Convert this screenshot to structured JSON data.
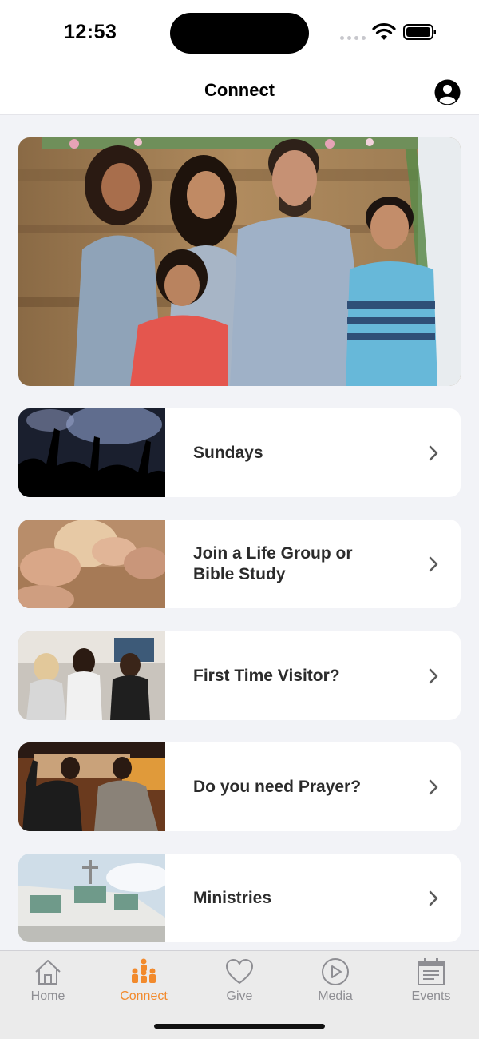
{
  "status": {
    "time": "12:53"
  },
  "nav": {
    "title": "Connect"
  },
  "colors": {
    "accent": "#f28a2c",
    "inactive": "#8e8e93"
  },
  "list": [
    {
      "label": "Sundays",
      "icon": "chevron-right-icon"
    },
    {
      "label": "Join a Life Group or\nBible Study",
      "icon": "chevron-right-icon"
    },
    {
      "label": "First Time Visitor?",
      "icon": "chevron-right-icon"
    },
    {
      "label": "Do you need Prayer?",
      "icon": "chevron-right-icon"
    },
    {
      "label": "Ministries",
      "icon": "chevron-right-icon"
    }
  ],
  "tabs": [
    {
      "label": "Home",
      "icon": "house-icon",
      "active": false
    },
    {
      "label": "Connect",
      "icon": "people-icon",
      "active": true
    },
    {
      "label": "Give",
      "icon": "heart-icon",
      "active": false
    },
    {
      "label": "Media",
      "icon": "play-circle-icon",
      "active": false
    },
    {
      "label": "Events",
      "icon": "calendar-icon",
      "active": false
    }
  ]
}
